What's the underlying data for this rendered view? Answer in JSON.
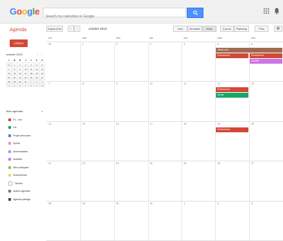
{
  "app": {
    "logo_letters": [
      {
        "ch": "G",
        "color": "#4285f4"
      },
      {
        "ch": "o",
        "color": "#ea4335"
      },
      {
        "ch": "o",
        "color": "#fbbc05"
      },
      {
        "ch": "g",
        "color": "#4285f4"
      },
      {
        "ch": "l",
        "color": "#34a853"
      },
      {
        "ch": "e",
        "color": "#ea4335"
      }
    ],
    "search_placeholder": "Search my calendars or Google",
    "brand": "Agenda",
    "apps_icon": "grid-icon",
    "notifications_icon": "bell-icon"
  },
  "toolbar": {
    "today": "Aujourd'hui",
    "prev": "‹",
    "next": "›",
    "date_title": "octobre 2013",
    "views": [
      "Jour",
      "Semaine",
      "Mois",
      "4 jours",
      "Planning"
    ],
    "selected_view": "Mois",
    "more": "Plus",
    "settings_icon": "gear-icon"
  },
  "sidebar": {
    "create_label": "CRÉER",
    "mini_title": "octobre 2013",
    "mini_head": [
      "L",
      "M",
      "M",
      "J",
      "V",
      "S",
      "D"
    ],
    "mini_weeks": [
      [
        "30",
        "1",
        "2",
        "3",
        "4",
        "5",
        "6"
      ],
      [
        "7",
        "8",
        "9",
        "10",
        "11",
        "12",
        "13"
      ],
      [
        "14",
        "15",
        "16",
        "17",
        "18",
        "19",
        "20"
      ],
      [
        "21",
        "22",
        "23",
        "24",
        "25",
        "26",
        "27"
      ],
      [
        "28",
        "29",
        "30",
        "31",
        "1",
        "2",
        "3"
      ],
      [
        "4",
        "5",
        "6",
        "7",
        "8",
        "9",
        "10"
      ]
    ],
    "my_calendars_label": "Mes agendas",
    "calendars": [
      {
        "label": "F1 - mix",
        "color": "#d14836"
      },
      {
        "label": "Lib",
        "color": "#16a765"
      },
      {
        "label": "Projet annonces",
        "color": "#4986e7"
      },
      {
        "label": "Sports",
        "color": "#f691b2"
      },
      {
        "label": "Anniversaires",
        "color": "#9a9cff"
      },
      {
        "label": "Activités",
        "color": "#cd74e6"
      },
      {
        "label": "Mes collègues",
        "color": "#7bd148"
      },
      {
        "label": "Événements",
        "color": "#fad165"
      },
      {
        "label": "Tâches",
        "color": "#ffffff"
      },
      {
        "label": "Autres agendas",
        "color": "#7a7a7a"
      },
      {
        "label": "Agenda partagé",
        "color": "#4a4a4a"
      }
    ]
  },
  "grid": {
    "days": [
      "lun.",
      "mar.",
      "mer.",
      "jeu.",
      "ven.",
      "sam.",
      "dim."
    ],
    "weeks": [
      [
        "30",
        "1",
        "2",
        "3",
        "4",
        "5",
        "6"
      ],
      [
        "7",
        "8",
        "9",
        "10",
        "11",
        "12",
        "13"
      ],
      [
        "14",
        "15",
        "16",
        "17",
        "18",
        "19",
        "20"
      ],
      [
        "21",
        "22",
        "23",
        "24",
        "25",
        "26",
        "27"
      ],
      [
        "28",
        "29",
        "30",
        "31",
        "1",
        "2",
        "3"
      ]
    ],
    "events": [
      {
        "week": 0,
        "day": 5,
        "span": 2,
        "row": 0,
        "label": "Week-end",
        "color": "#a06a51"
      },
      {
        "week": 0,
        "day": 5,
        "span": 1,
        "row": 1,
        "label": "Événement",
        "color": "#d14836"
      },
      {
        "week": 0,
        "day": 6,
        "span": 1,
        "row": 1,
        "label": "Événement",
        "color": "#d14836"
      },
      {
        "week": 0,
        "day": 6,
        "span": 1,
        "row": 2,
        "label": "Activité",
        "color": "#cd74e6"
      },
      {
        "week": 1,
        "day": 5,
        "span": 1,
        "row": 0,
        "label": "Événement",
        "color": "#d14836"
      },
      {
        "week": 1,
        "day": 5,
        "span": 1,
        "row": 1,
        "label": "Sortie",
        "color": "#16a765"
      },
      {
        "week": 2,
        "day": 5,
        "span": 1,
        "row": 0,
        "label": "Événement",
        "color": "#d14836"
      }
    ]
  }
}
